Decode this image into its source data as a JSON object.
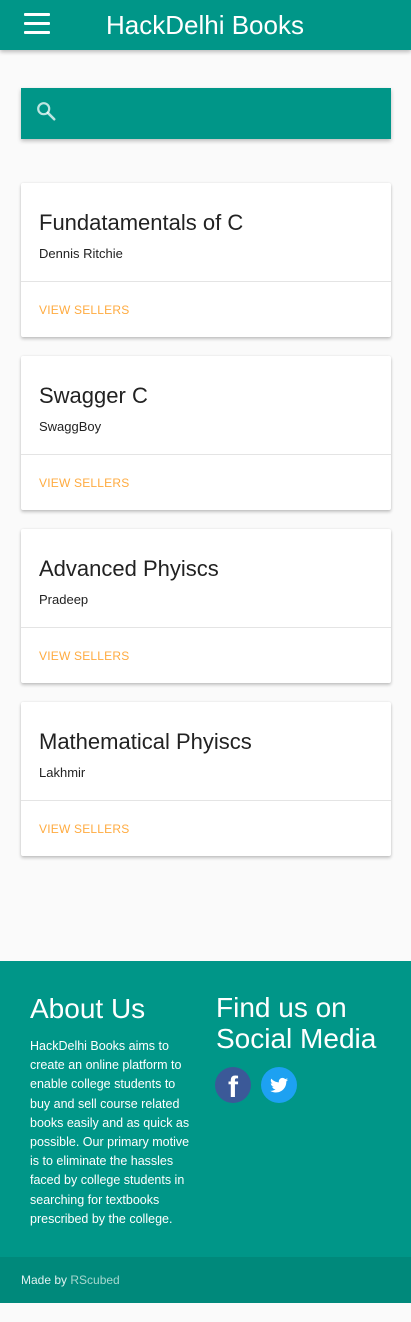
{
  "app": {
    "title": "HackDelhi Books"
  },
  "search": {
    "placeholder": "",
    "value": ""
  },
  "books": [
    {
      "title": "Fundatamentals of C",
      "author": "Dennis Ritchie",
      "action": "VIEW SELLERS"
    },
    {
      "title": "Swagger C",
      "author": "SwaggBoy",
      "action": "VIEW SELLERS"
    },
    {
      "title": "Advanced Phyiscs",
      "author": "Pradeep",
      "action": "VIEW SELLERS"
    },
    {
      "title": "Mathematical Phyiscs",
      "author": "Lakhmir",
      "action": "VIEW SELLERS"
    }
  ],
  "footer": {
    "about_heading": "About Us",
    "about_text": "HackDelhi Books aims to create an online platform to enable college students to buy and sell course related books easily and as quick as possible. Our primary motive is to eliminate the hassles faced by college students in searching for textbooks prescribed by the college.",
    "social_heading": "Find us on Social Media",
    "social_icons": [
      "facebook-icon",
      "twitter-icon"
    ],
    "made_by_prefix": "Made by ",
    "made_by_link": "RScubed"
  },
  "colors": {
    "primary": "#009688",
    "primary_dark": "#00897b",
    "accent": "#ffab40",
    "facebook": "#3b5998",
    "twitter": "#1da1f2"
  }
}
